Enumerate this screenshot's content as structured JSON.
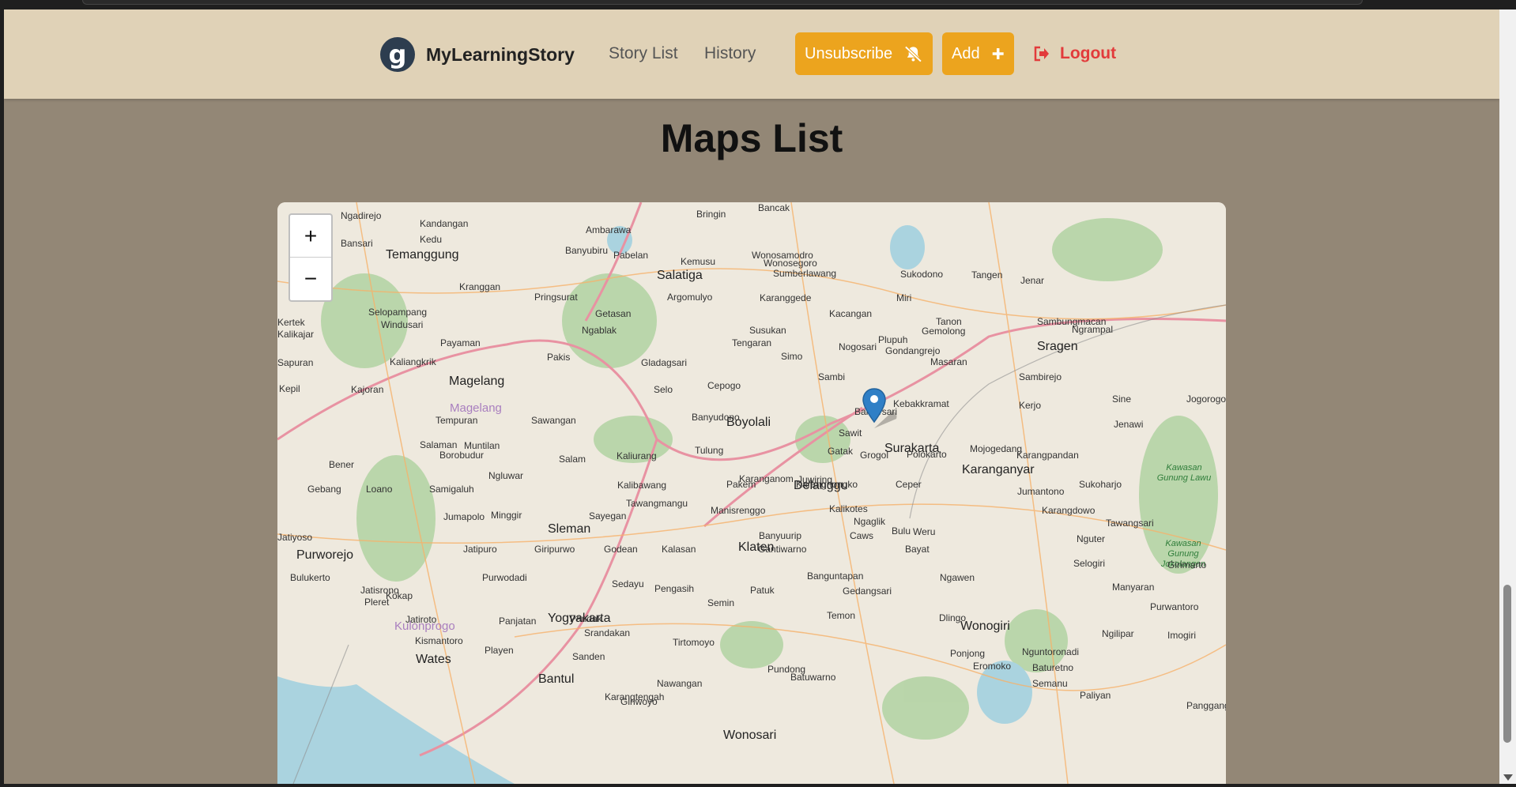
{
  "header": {
    "brand": "MyLearningStory",
    "logo_glyph": "g",
    "nav": [
      "Story List",
      "History"
    ],
    "unsubscribe_label": "Unsubscribe",
    "add_label": "Add",
    "logout_label": "Logout"
  },
  "page": {
    "title": "Maps List"
  },
  "map": {
    "zoom_in": "+",
    "zoom_out": "−",
    "cities": [
      "Temanggung",
      "Magelang",
      "Salatiga",
      "Boyolali",
      "Surakarta",
      "Karanganyar",
      "Sragen",
      "Delanggu",
      "Klaten",
      "Sleman",
      "Yogyakarta",
      "Bantul",
      "Wates",
      "Purworejo",
      "Wonogiri",
      "Wonosari"
    ],
    "areas": [
      "Magelang",
      "Kulonprogo"
    ],
    "parks": [
      "Kawasan Gunung Lawu",
      "Kawasan Gunung Jokolangan"
    ],
    "towns": [
      "Ngadirejo",
      "Kandangan",
      "Ambarawa",
      "Bringin",
      "Bancak",
      "Bansari",
      "Kedu",
      "Banyubiru",
      "Pabelan",
      "Wonosamodro",
      "Wonosegoro",
      "Kemusu",
      "Kranggan",
      "Pringsurat",
      "Argomulyo",
      "Karanggede",
      "Sumberlawang",
      "Sukodono",
      "Tangen",
      "Jenar",
      "Kertek",
      "Selopampang",
      "Getasan",
      "Kacangan",
      "Miri",
      "Tanon",
      "Sambungmacan",
      "Kalikajar",
      "Windusari",
      "Ngablak",
      "Susukan",
      "Gemolong",
      "Ngrampal",
      "Payaman",
      "Tengaran",
      "Plupuh",
      "Sapuran",
      "Kaliangkrik",
      "Pakis",
      "Gladagsari",
      "Simo",
      "Nogosari",
      "Gondangrejo",
      "Masaran",
      "Kajoran",
      "Sambi",
      "Sambirejo",
      "Selo",
      "Cepogo",
      "Kepil",
      "Tempuran",
      "Sawangan",
      "Banyudono",
      "Banjarsari",
      "Kebakkramat",
      "Kerjo",
      "Sine",
      "Jogorogo",
      "Sawit",
      "Jenawi",
      "Salaman",
      "Muntilan",
      "Tulung",
      "Gatak",
      "Grogol",
      "Mojogedang",
      "Borobudur",
      "Kaliurang",
      "Bener",
      "Salam",
      "Polokarto",
      "Karangpandan",
      "Ngluwar",
      "Karanganom",
      "Juwiring",
      "Jumantono",
      "Gebang",
      "Loano",
      "Samigaluh",
      "Kalibawang",
      "Pakem",
      "Karangnongko",
      "Ceper",
      "Sukoharjo",
      "Tawangmangu",
      "Manisrenggo",
      "Kalikotes",
      "Karangdowo",
      "Jumapolo",
      "Minggir",
      "Sayegan",
      "Ngaglik",
      "Tawangsari",
      "Jatiyoso",
      "Banyuurip",
      "Caws",
      "Weru",
      "Bulu",
      "Nguter",
      "Jatipuro",
      "Giripurwo",
      "Godean",
      "Kalasan",
      "Gantiwarno",
      "Bayat",
      "Selogiri",
      "Girimarto",
      "Bulukerto",
      "Purwodadi",
      "Sedayu",
      "Banguntapan",
      "Ngawen",
      "Manyaran",
      "Jatisrono",
      "Kokap",
      "Pengasih",
      "Patuk",
      "Gedangsari",
      "Purwantoro",
      "Pleret",
      "Semin",
      "Temon",
      "Ngilipar",
      "Jatiroto",
      "Panjatan",
      "Pandak",
      "Imogiri",
      "Kismantoro",
      "Srandakan",
      "Dlingo",
      "Nguntoronadi",
      "Tirtomoyo",
      "Playen",
      "Sanden",
      "Pundong",
      "Ponjong",
      "Eromoko",
      "Baturetno",
      "Batuwarno",
      "Semanu",
      "Nawangan",
      "Paliyan",
      "Karangtengah",
      "Panggang",
      "Giriwoyo"
    ]
  },
  "colors": {
    "header_bg": "#e0d2b7",
    "page_bg": "#938776",
    "accent": "#eca41e",
    "logout": "#e23b3b"
  },
  "icons": [
    "logo-icon",
    "bell-slash-icon",
    "plus-icon",
    "logout-icon",
    "map-marker-icon"
  ]
}
